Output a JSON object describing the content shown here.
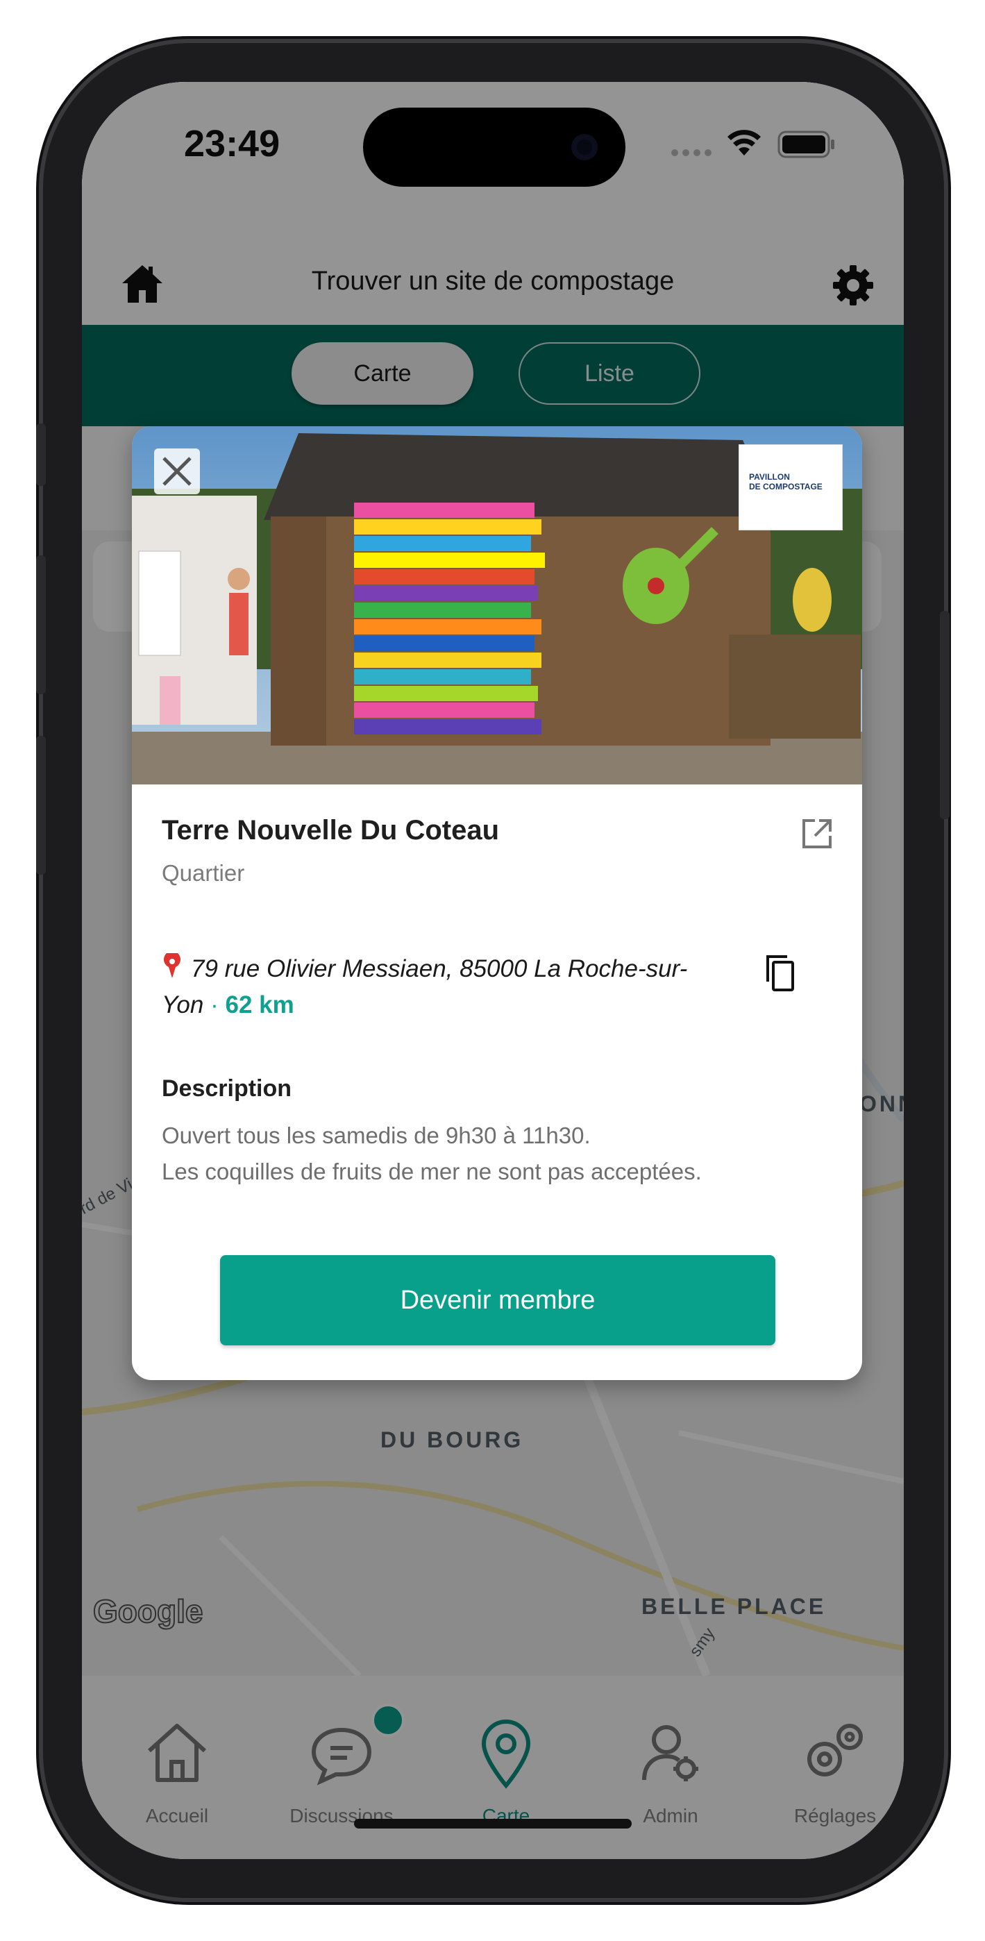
{
  "status": {
    "time": "23:49"
  },
  "header": {
    "title": "Trouver un site de compostage"
  },
  "tabs": [
    {
      "label": "Carte"
    },
    {
      "label": "Liste"
    }
  ],
  "map": {
    "labels": [
      "DU BOURG",
      "BELLE PLACE"
    ],
    "partial_labels": [
      "ONN",
      "rd de Vi",
      "smy"
    ],
    "attribution": "Google"
  },
  "modal": {
    "logo_text": [
      "PAVILLON",
      "DE COMPOSTAGE"
    ],
    "name": "Terre Nouvelle Du Coteau",
    "type": "Quartier",
    "address": "79 rue Olivier Messiaen, 85000 La Roche-sur-Yon",
    "address_line1": "79 rue Olivier Messiaen, 85000 La Roche-sur-",
    "address_line2": "Yon",
    "separator": "·",
    "distance": "62 km",
    "description_title": "Description",
    "description_lines": [
      "Ouvert tous les samedis de 9h30 à 11h30.",
      "Les coquilles de fruits de mer ne sont pas acceptées."
    ],
    "cta_label": "Devenir membre"
  },
  "nav": [
    {
      "label": "Accueil",
      "icon": "home-icon"
    },
    {
      "label": "Discussions",
      "icon": "chat-icon",
      "badge": true
    },
    {
      "label": "Carte",
      "icon": "map-pin-icon",
      "active": true
    },
    {
      "label": "Admin",
      "icon": "admin-icon"
    },
    {
      "label": "Réglages",
      "icon": "settings-icon"
    }
  ],
  "colors": {
    "primary": "#006b5d",
    "accent": "#089f8b",
    "distance": "#10a08f"
  }
}
